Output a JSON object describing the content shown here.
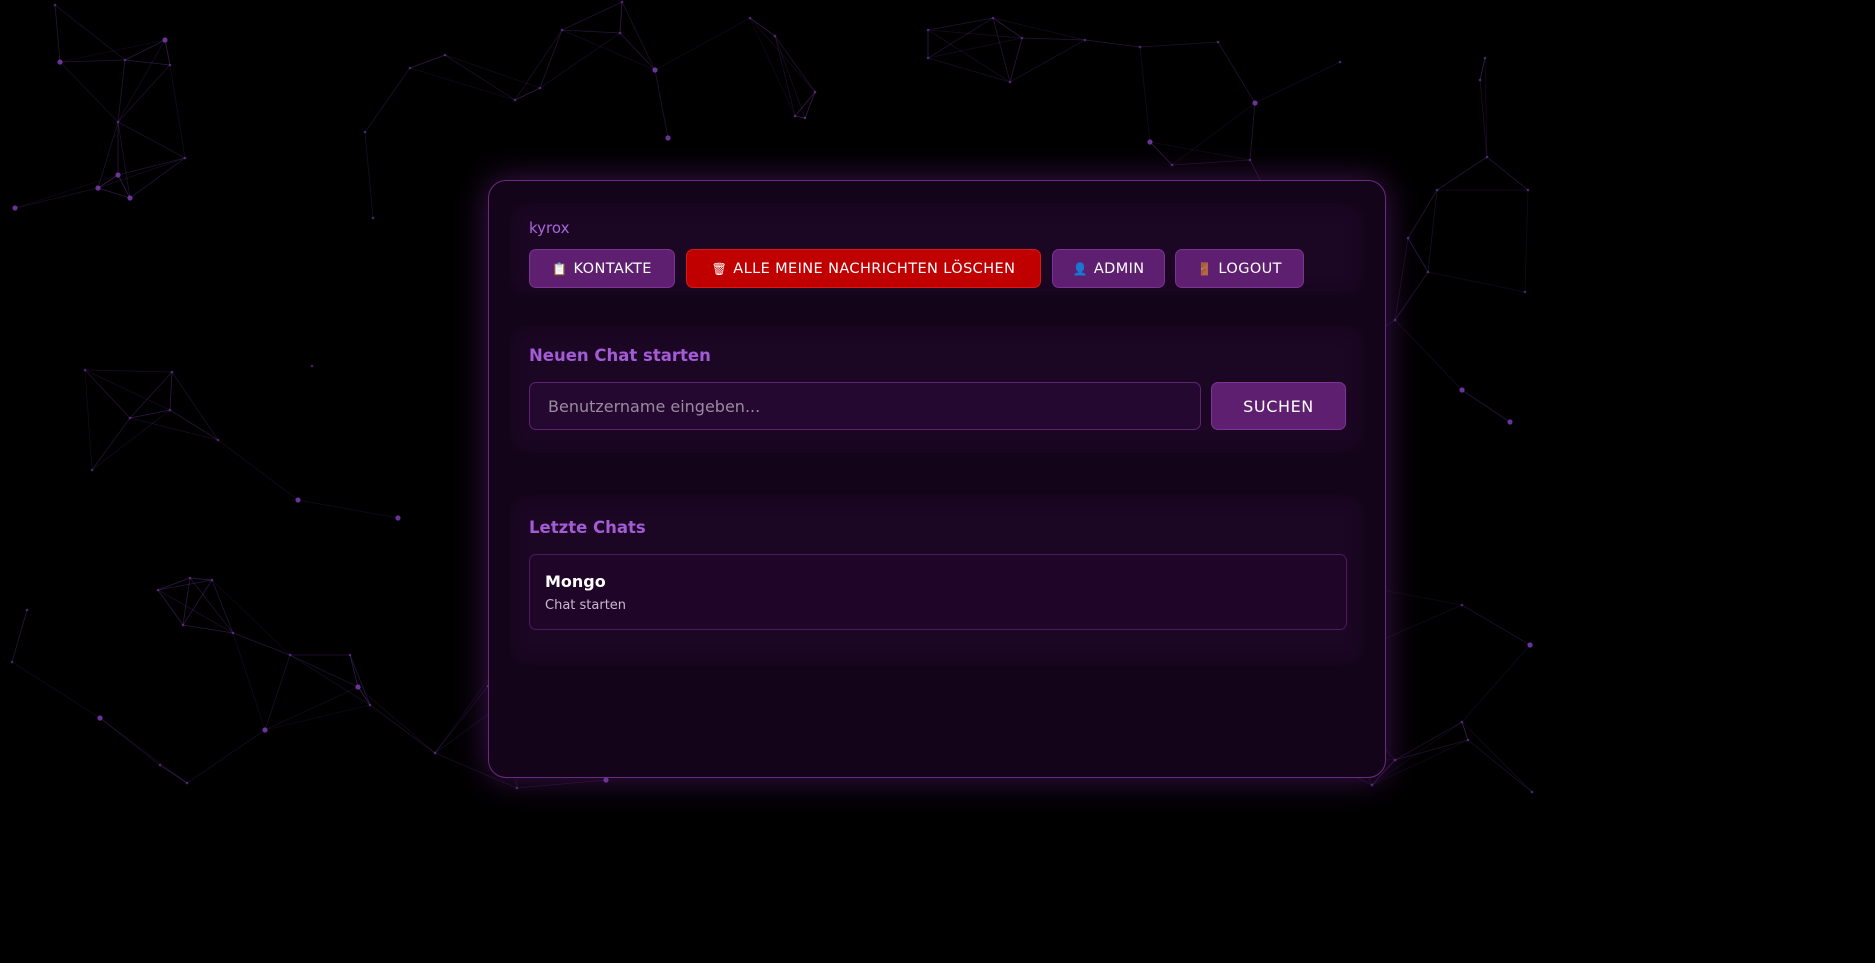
{
  "user": {
    "name": "kyrox"
  },
  "toolbar": {
    "contacts_label": "KONTAKTE",
    "delete_all_label": "ALLE MEINE NACHRICHTEN LÖSCHEN",
    "admin_label": "ADMIN",
    "logout_label": "LOGOUT",
    "contacts_icon": "📋",
    "delete_icon": "🗑",
    "admin_icon": "👤",
    "logout_icon": "🚪"
  },
  "new_chat": {
    "title": "Neuen Chat starten",
    "placeholder": "Benutzername eingeben...",
    "search_label": "SUCHEN"
  },
  "recent": {
    "title": "Letzte Chats",
    "items": [
      {
        "name": "Mongo",
        "subtitle": "Chat starten"
      }
    ]
  },
  "colors": {
    "background": "#000000",
    "accent": "#a35bd6",
    "button": "#5e1f70",
    "danger": "#c00000",
    "network": "#7a3cb0"
  }
}
